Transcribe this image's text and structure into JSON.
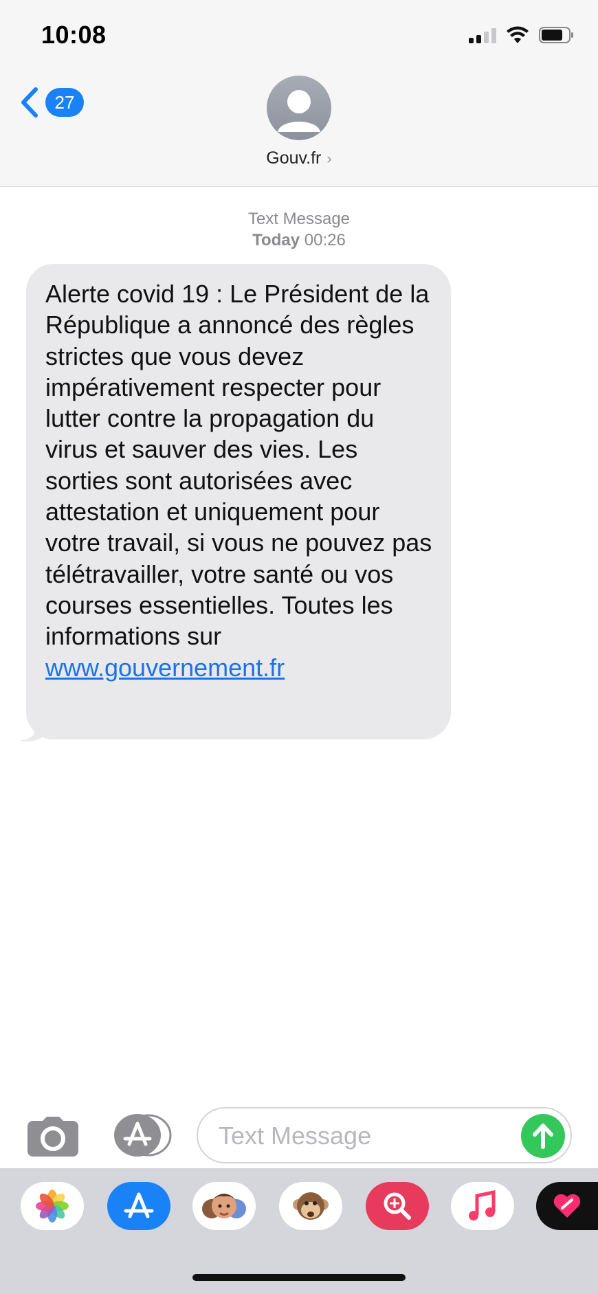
{
  "status_bar": {
    "time": "10:08"
  },
  "nav": {
    "back_count": "27",
    "contact_name": "Gouv.fr",
    "contact_chevron": "›"
  },
  "thread": {
    "meta_label": "Text Message",
    "meta_day": "Today",
    "meta_time": "00:26",
    "message_text": "Alerte covid 19 : Le Président de la République a annoncé des règles strictes que vous devez impérativement respecter pour lutter contre la propagation du virus et sauver des vies. Les sorties sont autorisées avec attestation et uniquement pour votre travail, si vous ne pouvez pas télétravailler, votre santé ou vos courses essentielles. Toutes les informations sur",
    "message_link": "www.gouvernement.fr"
  },
  "composer": {
    "placeholder": "Text Message"
  },
  "app_drawer": {
    "apps": [
      "photos-icon",
      "app-store-icon",
      "memoji-icon",
      "animoji-monkey-icon",
      "search-images-icon",
      "music-icon",
      "digital-touch-icon"
    ]
  },
  "colors": {
    "accent_blue": "#1a82f7",
    "bubble_gray": "#e9e9eb",
    "send_green": "#34c759",
    "link_blue": "#1a73e8"
  }
}
